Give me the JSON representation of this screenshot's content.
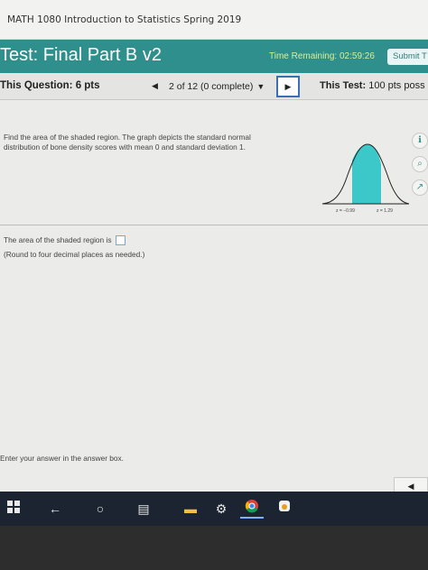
{
  "course": {
    "title": "MATH 1080 Introduction to Statistics Spring 2019"
  },
  "test": {
    "title": "Test: Final Part B v2",
    "time_remaining": "Time Remaining: 02:59:26",
    "submit_label": "Submit T"
  },
  "nav": {
    "this_question": "This Question: 6 pts",
    "prev_icon": "◀",
    "counter": "2 of 12 (0 complete)",
    "counter_caret": "▼",
    "next_icon": "▶",
    "this_test_label": "This Test:",
    "this_test_value": "100 pts poss"
  },
  "problem": {
    "text": "Find the area of the shaded region. The graph depicts the standard normal distribution of bone density scores with mean 0 and standard deviation 1.",
    "z_left": "z = −0.99",
    "z_right": "z = 1.29"
  },
  "answer": {
    "prompt": "The area of the shaded region is",
    "round_note": "(Round to four decimal places as needed.)",
    "enter_note": "Enter your answer in the answer box."
  },
  "taskbar": {
    "items": [
      "windows-icon",
      "back-icon",
      "cortana-icon",
      "task-view-icon",
      "file-explorer-icon",
      "settings-icon",
      "chrome-icon",
      "app-icon"
    ]
  },
  "colors": {
    "teal_header": "#2f8f8c",
    "shade_fill": "#3cc8c8",
    "taskbar": "#1c2331"
  }
}
